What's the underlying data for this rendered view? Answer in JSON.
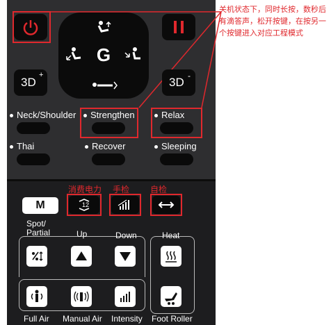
{
  "note": {
    "text": "关机状态下，同时长按，数秒后有滴答声，松开按键，在按另一个按键进入对应工程模式"
  },
  "top": {
    "center_label": "G",
    "btn_3d_plus": "3D",
    "btn_3d_plus_sup": "+",
    "btn_3d_minus": "3D",
    "btn_3d_minus_sup": "-",
    "modes": [
      {
        "label": "Neck/Shoulder"
      },
      {
        "label": "Strengthen"
      },
      {
        "label": "Relax"
      },
      {
        "label": "Thai"
      },
      {
        "label": "Recover"
      },
      {
        "label": "Sleeping"
      }
    ]
  },
  "bottom": {
    "m_label": "M",
    "red_labels": {
      "power_consumption": "消费电力",
      "hand_check": "手检",
      "self_check": "自检"
    },
    "spot_label": "Spot/\nPartial",
    "up_label": "Up",
    "down_label": "Down",
    "heat_label": "Heat",
    "full_air_label": "Full Air",
    "manual_air_label": "Manual Air",
    "intensity_label": "Intensity",
    "foot_roller_label": "Foot Roller"
  },
  "colors": {
    "accent_red": "#e0282d",
    "panel_top": "#2e2e30",
    "panel_bottom": "#1d1d1f"
  }
}
